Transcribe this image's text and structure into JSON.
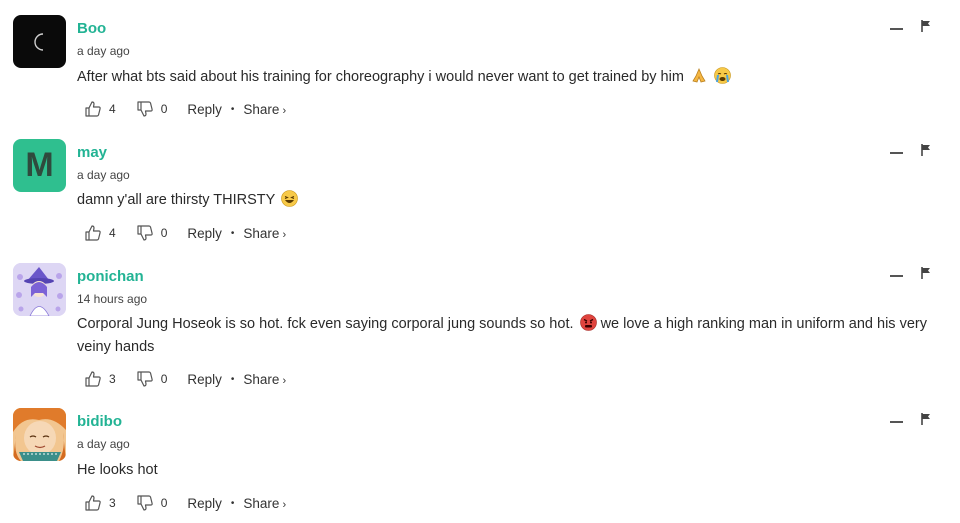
{
  "comments": [
    {
      "username": "Boo",
      "timestamp": "a day ago",
      "text": "After what bts said about his training for choreography i would never want to get trained by him",
      "emojis": [
        "folded-hands-emoji",
        "crying-face-emoji"
      ],
      "likes": "4",
      "dislikes": "0",
      "avatar": {
        "type": "crescent-moon-icon",
        "bg": "#0a0a0a"
      }
    },
    {
      "username": "may",
      "timestamp": "a day ago",
      "text": "damn y'all are thirsty THIRSTY",
      "emojis": [
        "laughing-face-emoji"
      ],
      "likes": "4",
      "dislikes": "0",
      "avatar": {
        "type": "letter",
        "letter": "M",
        "bg": "#2fbf8f"
      }
    },
    {
      "username": "ponichan",
      "timestamp": "14 hours ago",
      "text": "Corporal Jung Hoseok is so hot. fck even saying corporal jung sounds so hot.",
      "text_after_emoji": "we love a high ranking man in uniform and his very veiny hands",
      "emojis": [
        "angry-face-emoji"
      ],
      "likes": "3",
      "dislikes": "0",
      "avatar": {
        "type": "witch-anime-image",
        "bg": "#d9d2f2"
      }
    },
    {
      "username": "bidibo",
      "timestamp": "a day ago",
      "text": "He looks hot",
      "emojis": [],
      "likes": "3",
      "dislikes": "0",
      "avatar": {
        "type": "anime-character-image",
        "bg": "#e8a35a"
      }
    }
  ],
  "actions": {
    "reply": "Reply",
    "separator": "•",
    "share": "Share",
    "share_chevron": "›"
  },
  "colors": {
    "username": "#22b394",
    "text": "#2a2a2a"
  }
}
